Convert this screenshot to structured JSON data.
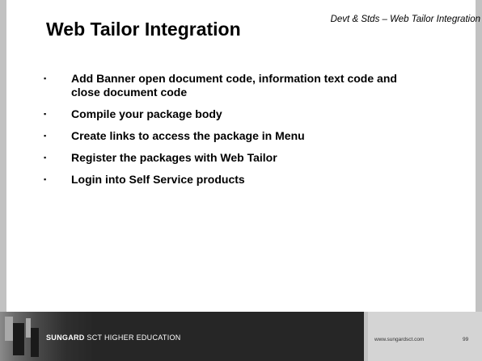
{
  "header": {
    "note": "Devt & Stds – Web Tailor Integration",
    "title": "Web Tailor Integration"
  },
  "bullets": [
    {
      "marker": "▪",
      "text": "Add Banner open document code, information text code and close document code"
    },
    {
      "marker": "▪",
      "text": "Compile your package body"
    },
    {
      "marker": "▪",
      "text": "Create links to access the package in Menu"
    },
    {
      "marker": "▪",
      "text": "Register the packages with Web Tailor"
    },
    {
      "marker": "▪",
      "text": "Login into Self Service products"
    }
  ],
  "footer": {
    "brand_strong": "SUNGARD",
    "brand_rest": "SCT HIGHER EDUCATION",
    "url": "www.sungardsct.com",
    "page_number": "99"
  },
  "colors": {
    "background": "#c2c2c2",
    "panel": "#ffffff",
    "footer_dark": "#262626",
    "footer_light": "#d4d4d4"
  }
}
